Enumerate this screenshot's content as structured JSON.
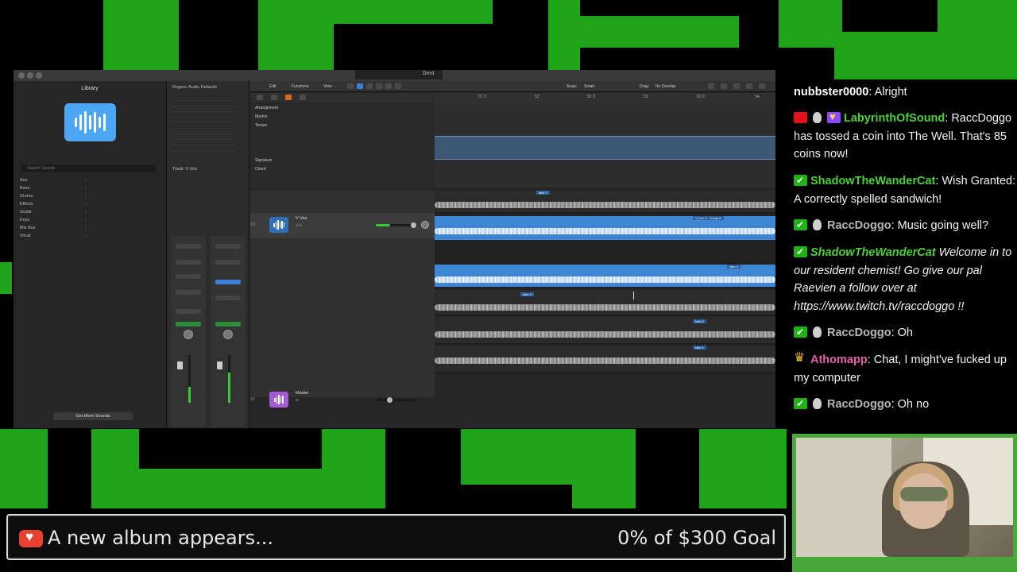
{
  "daw": {
    "library_title": "Library",
    "library_search_placeholder": "Search Sounds",
    "library_items": [
      "Aux",
      "Bass",
      "Drums",
      "Effects",
      "Guitar",
      "Keys",
      "Mix Bus",
      "Vocal"
    ],
    "get_more_sounds": "Get More Sounds",
    "inspector_region": "Region: Audio Defaults",
    "inspector_track": "Track: V Vox",
    "toolbar": {
      "edit": "Edit",
      "functions": "Functions",
      "view": "View",
      "snap_label": "Snap:",
      "snap_value": "Smart",
      "drag_label": "Drag:",
      "drag_value": "No Overlap"
    },
    "global_tracks": [
      "Arrangement",
      "Marker",
      "Tempo",
      "Signature",
      "Chord"
    ],
    "ruler_marks": [
      "51 3",
      "52",
      "52 3",
      "53",
      "53 3",
      "54"
    ],
    "tracks": [
      {
        "number": "29",
        "name": "V Vox",
        "buttons": "M S"
      },
      {
        "number": "30",
        "name": "Master",
        "buttons": "M"
      }
    ],
    "region_labels": [
      "take 1",
      "V Vox: 3 - Comp A",
      "take 4",
      "take 3",
      "take 2",
      "take 1"
    ]
  },
  "chat": [
    {
      "badges": [],
      "user": "nubbster0000",
      "user_color": "#ffffff",
      "text": "Alright",
      "italic": false
    },
    {
      "badges": [
        "video-badge-icon",
        "ghost-badge-icon",
        "heart-badge-icon"
      ],
      "user": "LabyrinthOfSound",
      "user_color": "#4cd137",
      "text": "RaccDoggo has tossed a coin into The Well. That's 85 coins now!",
      "italic": false
    },
    {
      "badges": [
        "check-badge-icon"
      ],
      "user": "ShadowTheWanderCat",
      "user_color": "#4cd137",
      "text": "Wish Granted: A correctly spelled sandwich!",
      "italic": false
    },
    {
      "badges": [
        "check-badge-icon",
        "ghost-badge-icon"
      ],
      "user": "RaccDoggo",
      "user_color": "#b8b8b8",
      "text": "Music going well?",
      "italic": false
    },
    {
      "badges": [
        "check-badge-icon"
      ],
      "user": "ShadowTheWanderCat",
      "user_color": "#4cd137",
      "text": "Welcome in to our resident chemist! Go give our pal Raevien a follow over at https://www.twitch.tv/raccdoggo !!",
      "italic": true
    },
    {
      "badges": [
        "check-badge-icon",
        "ghost-badge-icon"
      ],
      "user": "RaccDoggo",
      "user_color": "#b8b8b8",
      "text": "Oh",
      "italic": false
    },
    {
      "badges": [
        "crown-badge-icon"
      ],
      "user": "Athomapp",
      "user_color": "#e35fa7",
      "text": "Chat, I might've fucked up my computer",
      "italic": false
    },
    {
      "badges": [
        "check-badge-icon",
        "ghost-badge-icon"
      ],
      "user": "RaccDoggo",
      "user_color": "#b8b8b8",
      "text": "Oh no",
      "italic": false
    }
  ],
  "goal": {
    "title": "A new album appears...",
    "progress_text": "0% of $300 Goal",
    "accent": "#e8412f"
  }
}
